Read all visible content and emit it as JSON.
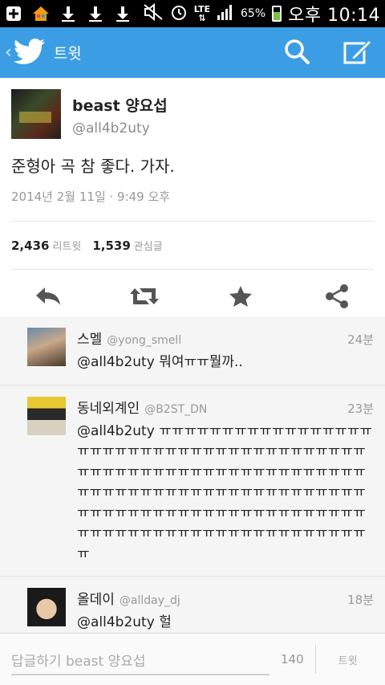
{
  "status_bar": {
    "network": "LTE",
    "battery": "65%",
    "time": "오후 10:14",
    "icons": [
      "plus-icon",
      "home-app-icon",
      "download-icon",
      "download-icon",
      "download-icon",
      "mute-icon",
      "alarm-icon",
      "lte-icon",
      "signal-icon",
      "battery-icon"
    ]
  },
  "action_bar": {
    "title": "트윗",
    "accent_color": "#3b9ee5",
    "icons": [
      "back-chevron-icon",
      "twitter-bird-icon",
      "search-icon",
      "compose-icon"
    ]
  },
  "tweet": {
    "display_name": "beast 양요섭",
    "handle": "@all4b2uty",
    "text": "준형아 곡 참 좋다. 가자.",
    "timestamp": "2014년 2월 11일 · 9:49 오후",
    "retweet_count": "2,436",
    "retweet_label": "리트윗",
    "favorite_count": "1,539",
    "favorite_label": "관심글",
    "actions": [
      "reply-icon",
      "retweet-icon",
      "favorite-icon",
      "share-icon"
    ]
  },
  "replies": [
    {
      "name": "스멜",
      "handle": "@yong_smell",
      "time": "24분",
      "text": "@all4b2uty 뭐여ㅠㅠ뭘까.."
    },
    {
      "name": "동네외계인",
      "handle": "@B2ST_DN",
      "time": "23분",
      "text": "@all4b2uty ㅠㅠㅠㅠㅠㅠㅠㅠㅠㅠㅠㅠㅠㅠㅠㅠㅠㅠㅠㅠㅠㅠㅠㅠㅠㅠㅠㅠㅠㅠㅠㅠㅠㅠㅠㅠㅠㅠㅠㅠㅠㅠㅠㅠㅠㅠㅠㅠㅠㅠㅠㅠㅠㅠㅠㅠㅠㅠㅠㅠㅠㅠㅠㅠㅠㅠㅠㅠㅠㅠㅠㅠㅠㅠㅠㅠㅠㅠㅠㅠㅠㅠㅠㅠㅠㅠㅠㅠㅠㅠㅠㅠㅠㅠㅠㅠㅠㅠㅠㅠㅠㅠㅠㅠㅠㅠㅠㅠㅠㅠㅠㅠㅠㅠㅠㅠㅠㅠㅠㅠㅠㅠㅠㅠㅠㅠㅠㅠㅠㅠㅠㅠㅠ"
    },
    {
      "name": "올데이",
      "handle": "@allday_dj",
      "time": "18분",
      "text": "@all4b2uty 헐"
    }
  ],
  "compose": {
    "placeholder": "답글하기 beast 양요섭",
    "char_count": "140",
    "tweet_button": "트윗"
  }
}
